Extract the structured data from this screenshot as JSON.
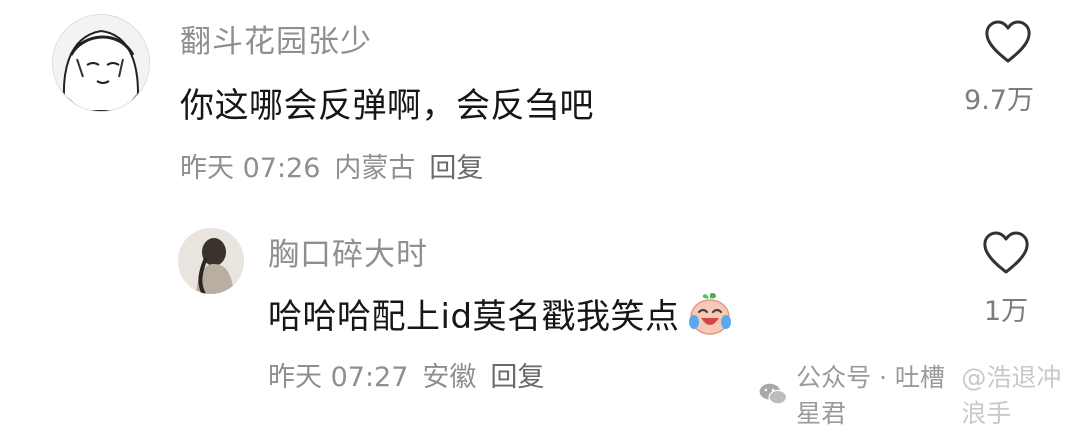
{
  "comments": [
    {
      "username": "翻斗花园张少",
      "content": "你这哪会反弹啊，会反刍吧",
      "time": "昨天 07:26",
      "location": "内蒙古",
      "reply_label": "回复",
      "like_count": "9.7万",
      "avatar_icon": "anime-girl-avatar"
    },
    {
      "username": "胸口碎大时",
      "content": "哈哈哈配上id莫名戳我笑点",
      "time": "昨天 07:27",
      "location": "安徽",
      "reply_label": "回复",
      "like_count": "1万",
      "emoji_icon": "laughing-tears-emoji",
      "avatar_icon": "photo-avatar"
    }
  ],
  "watermark": {
    "account": "公众号 · 吐槽星君",
    "overlay": "@浩退冲浪手"
  }
}
